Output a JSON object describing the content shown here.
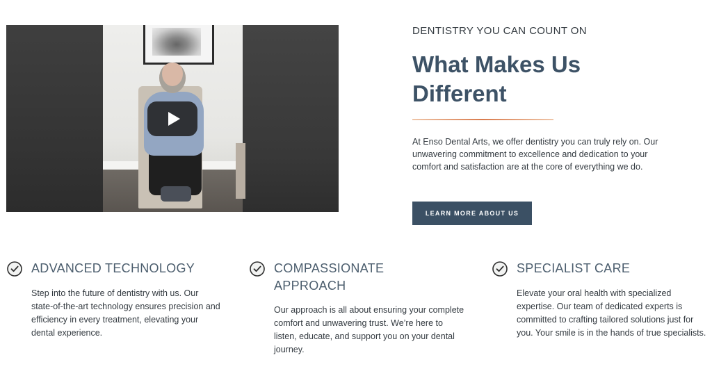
{
  "video": {
    "play_icon": "play-icon"
  },
  "intro": {
    "kicker": "DENTISTRY YOU CAN COUNT ON",
    "headline_line1": "What Makes Us",
    "headline_line2": "Different",
    "paragraph": "At Enso Dental Arts, we offer dentistry you can truly rely on. Our unwavering commitment to excellence and dedication to your comfort and satisfaction are at the core of everything we do.",
    "cta_label": "LEARN MORE ABOUT US"
  },
  "features": [
    {
      "icon": "check-circle-icon",
      "title": "ADVANCED TECHNOLOGY",
      "body": "Step into the future of dentistry with us. Our state-of-the-art technology ensures precision and efficiency in every treatment, elevating your dental experience."
    },
    {
      "icon": "check-circle-icon",
      "title": "COMPASSIONATE APPROACH",
      "body": "Our approach is all about ensuring your complete comfort and unwavering trust. We’re here to listen, educate, and support you on your dental journey."
    },
    {
      "icon": "check-circle-icon",
      "title": "SPECIALIST CARE",
      "body": "Elevate your oral health with specialized expertise. Our team of dedicated experts is committed to crafting tailored solutions just for you. Your smile is in the hands of true specialists."
    }
  ],
  "colors": {
    "heading": "#3d5266",
    "button": "#3b5064",
    "accent_divider": "#d97b4d"
  }
}
